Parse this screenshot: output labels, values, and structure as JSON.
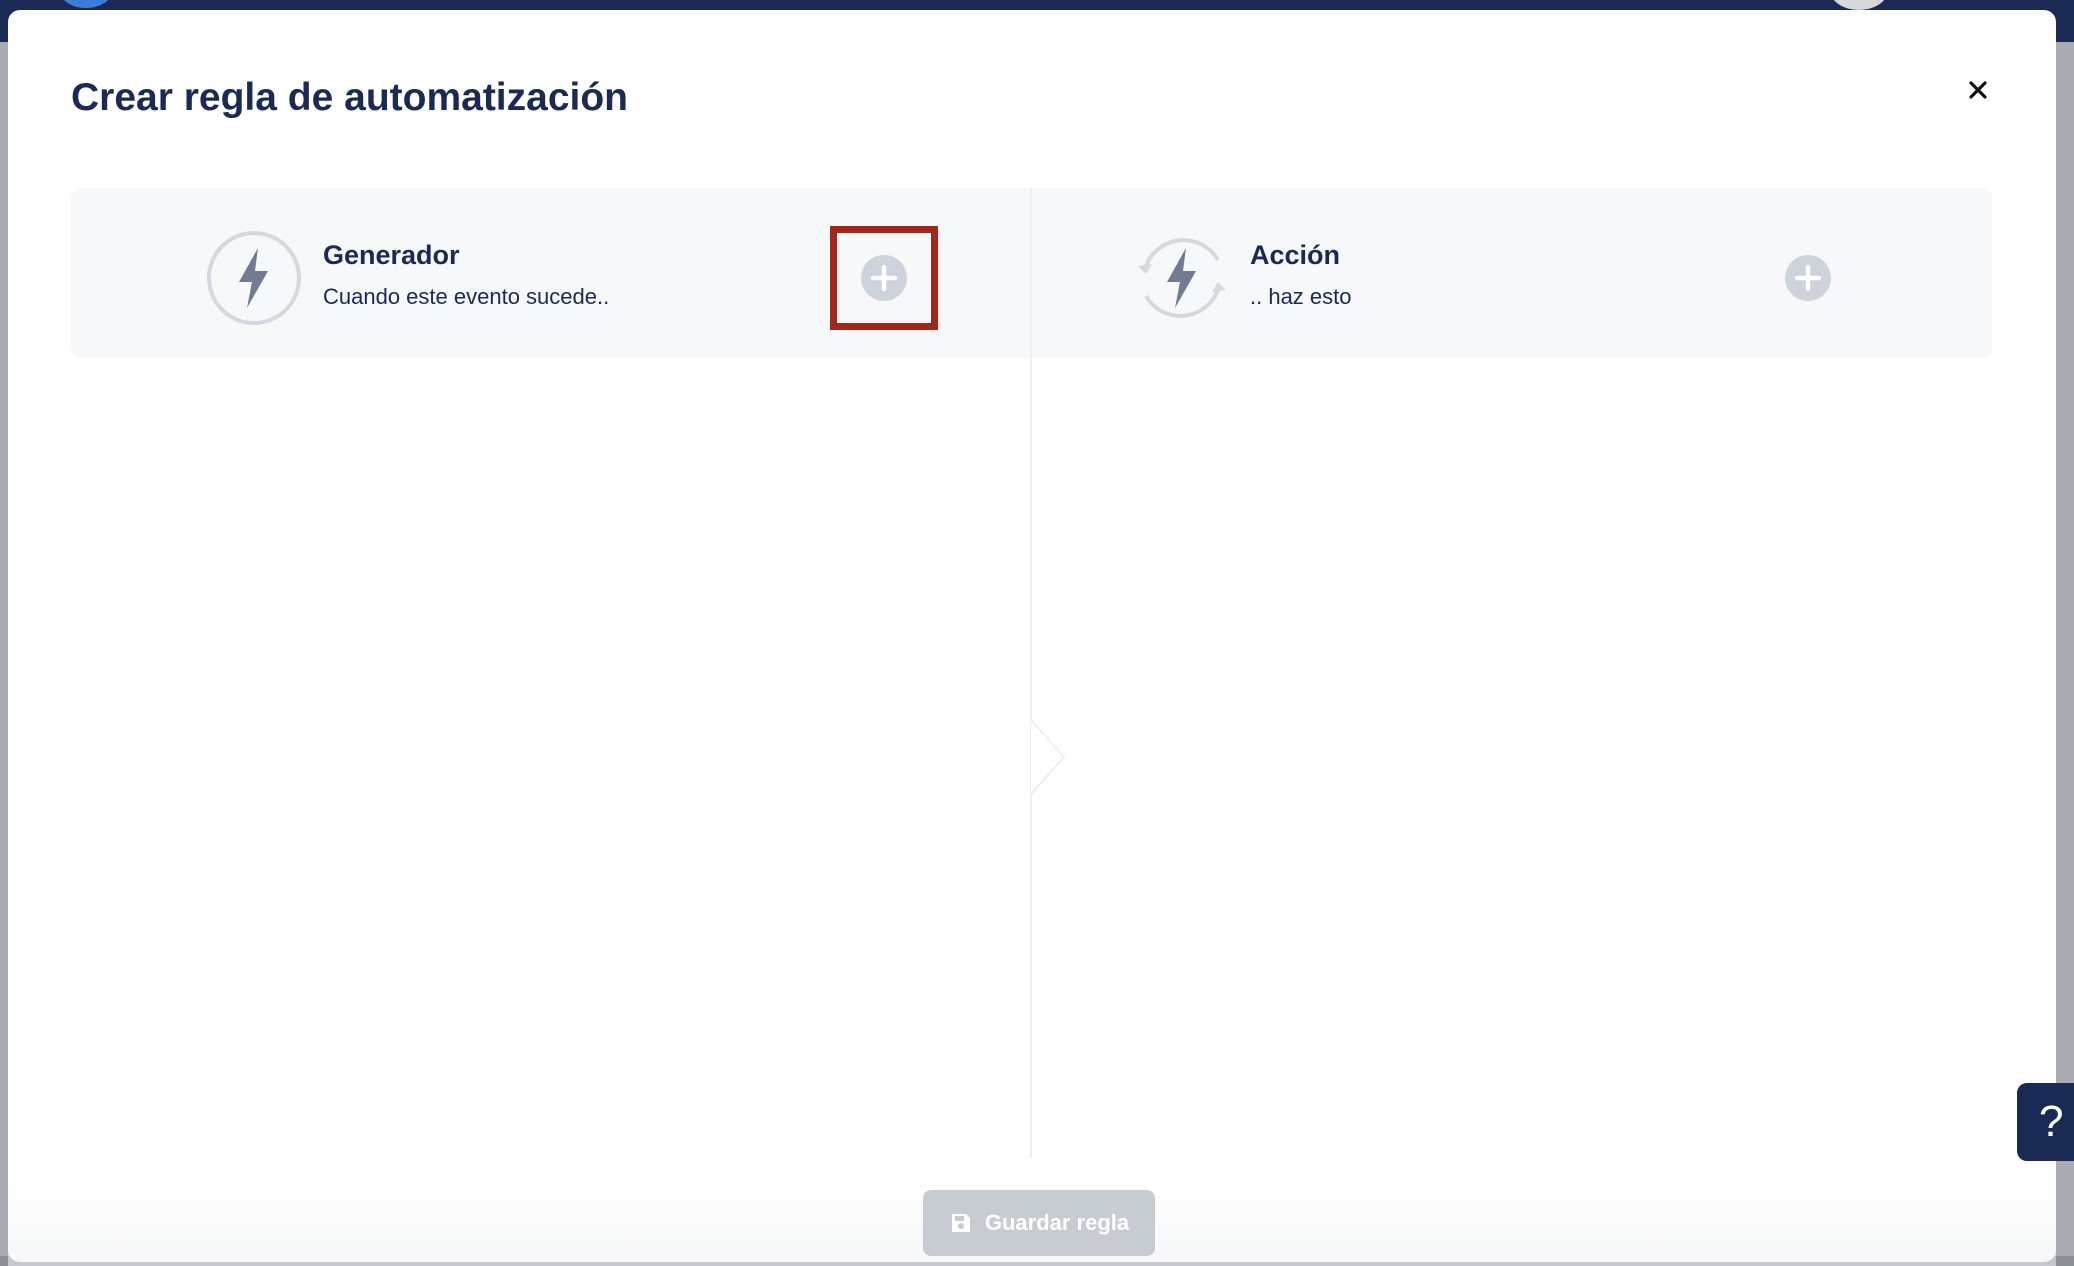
{
  "modal": {
    "title": "Crear regla de automatización",
    "close_icon": "close-icon"
  },
  "trigger": {
    "title": "Generador",
    "subtitle": "Cuando este evento sucede..",
    "icon": "lightning-icon",
    "add_icon": "plus-circle-icon"
  },
  "action": {
    "title": "Acción",
    "subtitle": ".. haz esto",
    "icon": "lightning-refresh-icon",
    "add_icon": "plus-circle-icon"
  },
  "footer": {
    "save_label": "Guardar regla",
    "save_icon": "floppy-disk-icon"
  },
  "help": {
    "label": "?"
  },
  "colors": {
    "primary": "#1b2a55",
    "highlight": "#a3261b",
    "icon_gray": "#c9d0da",
    "disabled_button": "#c7ccd3"
  }
}
